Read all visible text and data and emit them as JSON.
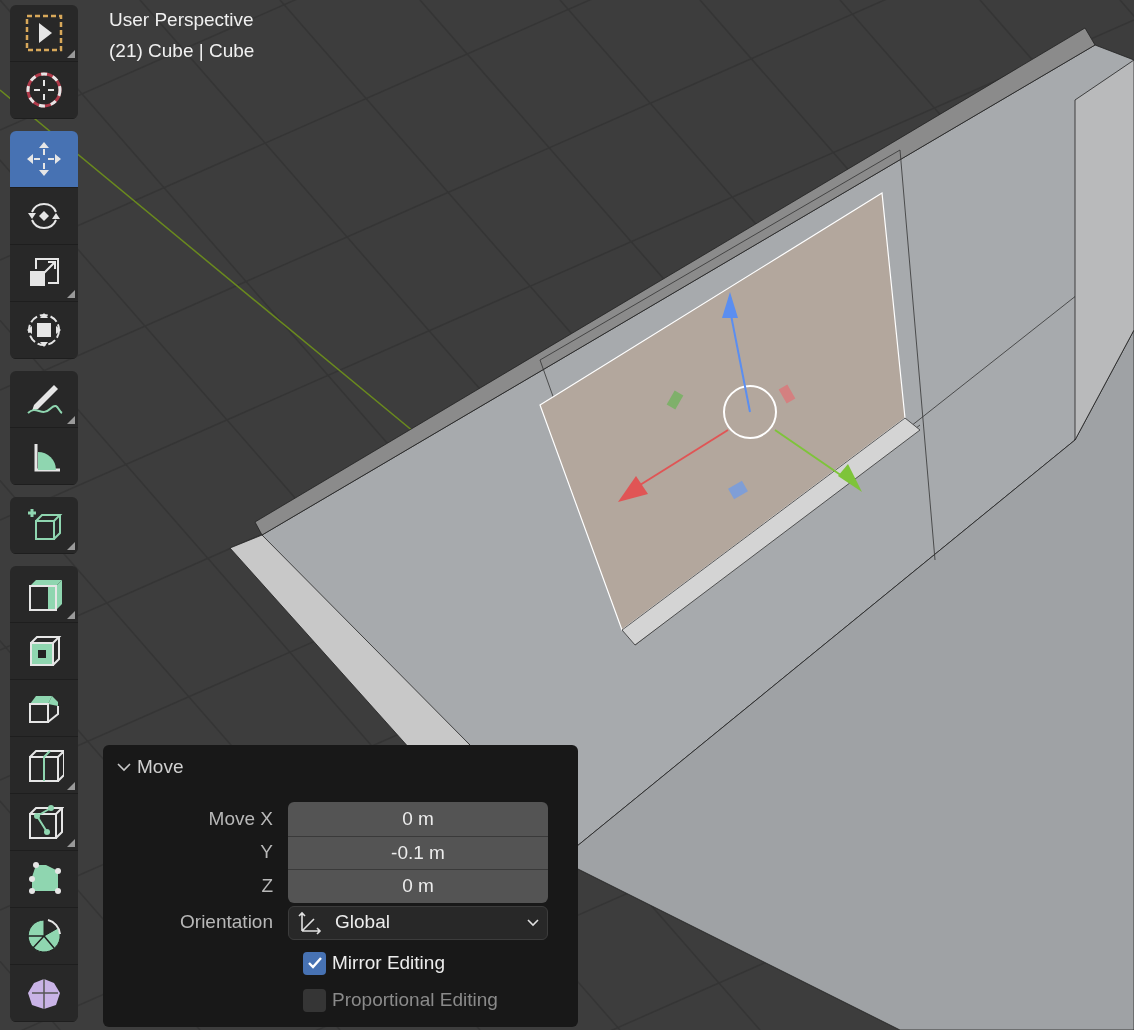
{
  "viewport": {
    "view_name": "User Perspective",
    "object_info": "(21) Cube | Cube"
  },
  "toolbar": {
    "groups": [
      {
        "tools": [
          {
            "kind": "select",
            "selected": false,
            "submenu": true
          },
          {
            "kind": "cursor",
            "selected": false,
            "submenu": false
          }
        ]
      },
      {
        "tools": [
          {
            "kind": "move",
            "selected": true,
            "submenu": false
          },
          {
            "kind": "rotate",
            "selected": false,
            "submenu": false
          },
          {
            "kind": "scale",
            "selected": false,
            "submenu": true
          },
          {
            "kind": "transform",
            "selected": false,
            "submenu": false
          }
        ]
      },
      {
        "tools": [
          {
            "kind": "annotate",
            "selected": false,
            "submenu": true
          },
          {
            "kind": "measure",
            "selected": false,
            "submenu": false
          }
        ]
      },
      {
        "tools": [
          {
            "kind": "add-cube",
            "selected": false,
            "submenu": true
          }
        ]
      },
      {
        "tools": [
          {
            "kind": "extrude",
            "selected": false,
            "submenu": true
          },
          {
            "kind": "inset",
            "selected": false,
            "submenu": false
          },
          {
            "kind": "bevel",
            "selected": false,
            "submenu": false
          },
          {
            "kind": "loop-cut",
            "selected": false,
            "submenu": true
          },
          {
            "kind": "knife",
            "selected": false,
            "submenu": true
          },
          {
            "kind": "poly-build",
            "selected": false,
            "submenu": false
          },
          {
            "kind": "spin",
            "selected": false,
            "submenu": false
          },
          {
            "kind": "smooth",
            "selected": false,
            "submenu": false
          }
        ]
      }
    ]
  },
  "operator_panel": {
    "title": "Move",
    "expanded": true,
    "fields": [
      {
        "label": "Move X",
        "value": "0 m"
      },
      {
        "label": "Y",
        "value": "-0.1 m"
      },
      {
        "label": "Z",
        "value": "0 m"
      }
    ],
    "orientation": {
      "label": "Orientation",
      "value": "Global"
    },
    "checkboxes": [
      {
        "label": "Mirror Editing",
        "checked": true,
        "disabled": false
      },
      {
        "label": "Proportional Editing",
        "checked": false,
        "disabled": true
      }
    ]
  }
}
